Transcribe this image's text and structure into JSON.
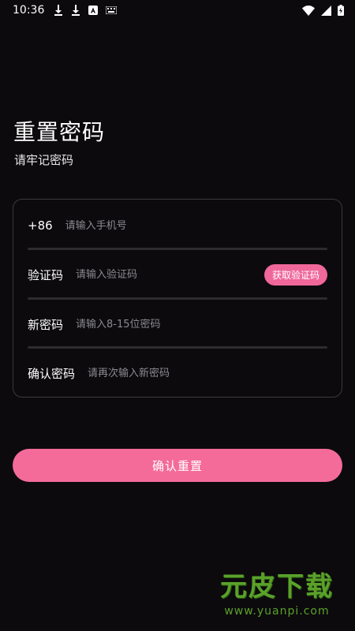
{
  "status_bar": {
    "time": "10:36"
  },
  "page": {
    "title": "重置密码",
    "subtitle": "请牢记密码"
  },
  "form": {
    "phone": {
      "label": "+86",
      "placeholder": "请输入手机号",
      "value": ""
    },
    "code": {
      "label": "验证码",
      "placeholder": "请输入验证码",
      "value": "",
      "button_label": "获取验证码"
    },
    "new_password": {
      "label": "新密码",
      "placeholder": "请输入8-15位密码",
      "value": ""
    },
    "confirm_password": {
      "label": "确认密码",
      "placeholder": "请再次输入新密码",
      "value": ""
    }
  },
  "submit": {
    "label": "确认重置"
  },
  "watermark": {
    "logo": "元皮下载",
    "url": "www.yuanpi.com"
  },
  "colors": {
    "background": "#0c0a0d",
    "accent": "#f46b9a",
    "card_border": "#3a3a3c",
    "placeholder": "#8a8a8e",
    "watermark": "#5aa12a"
  },
  "icons": {
    "status_left": [
      "download-icon",
      "download-icon",
      "app-a-icon",
      "keyboard-icon"
    ],
    "status_right": [
      "wifi-icon",
      "signal-icon",
      "battery-icon"
    ]
  }
}
